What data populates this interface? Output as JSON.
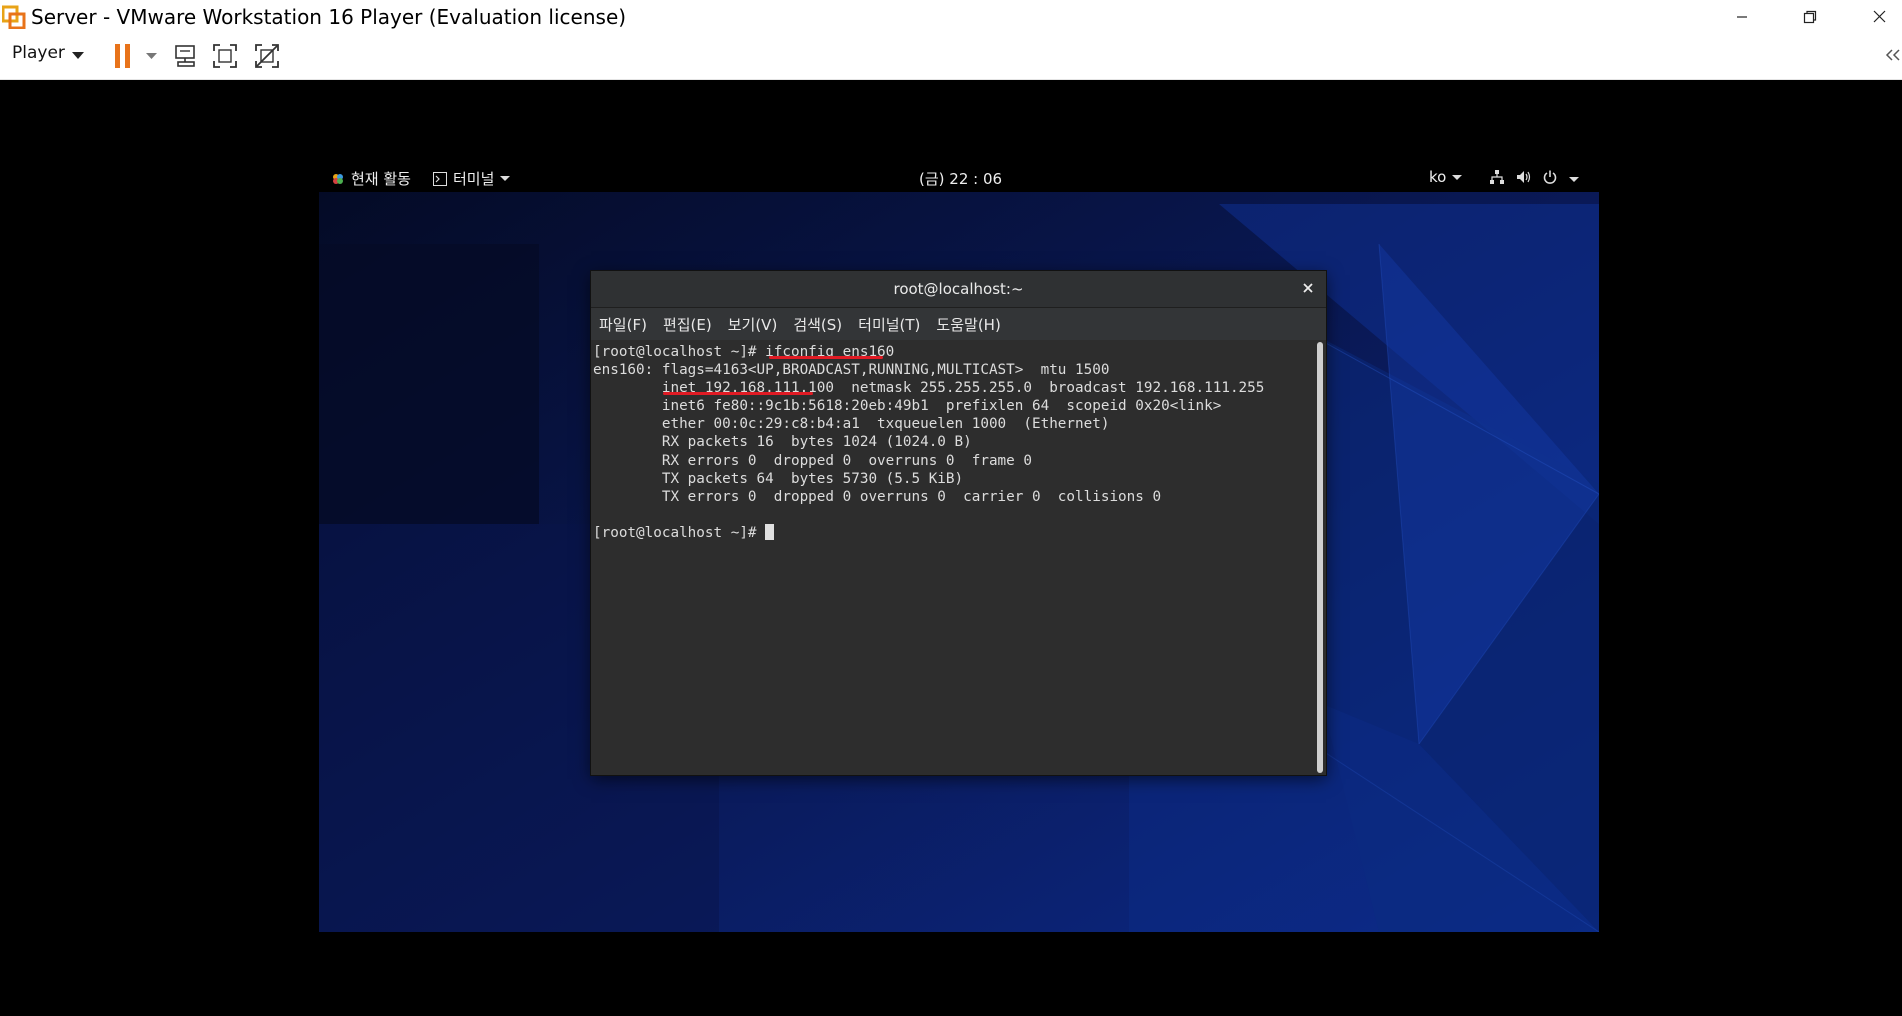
{
  "window": {
    "title": "Server - VMware Workstation 16 Player (Evaluation license)"
  },
  "toolbar": {
    "player_label": "Player",
    "icons": [
      "dropdown-icon",
      "pause-icon",
      "pause-menu-icon",
      "send-ctrl-alt-del-icon",
      "fullscreen-icon",
      "unity-icon",
      "collapse-icon"
    ]
  },
  "gnome_top_bar": {
    "activities": "현재 활동",
    "app_menu": "터미널",
    "clock": "(금) 22 : 06",
    "input_source": "ko"
  },
  "terminal": {
    "title": "root@localhost:~",
    "menu": [
      "파일(F)",
      "편집(E)",
      "보기(V)",
      "검색(S)",
      "터미널(T)",
      "도움말(H)"
    ],
    "lines": [
      "[root@localhost ~]# ifconfig ens160",
      "ens160: flags=4163<UP,BROADCAST,RUNNING,MULTICAST>  mtu 1500",
      "        inet 192.168.111.100  netmask 255.255.255.0  broadcast 192.168.111.255",
      "        inet6 fe80::9c1b:5618:20eb:49b1  prefixlen 64  scopeid 0x20<link>",
      "        ether 00:0c:29:c8:b4:a1  txqueuelen 1000  (Ethernet)",
      "        RX packets 16  bytes 1024 (1024.0 B)",
      "        RX errors 0  dropped 0  overruns 0  frame 0",
      "        TX packets 64  bytes 5730 (5.5 KiB)",
      "        TX errors 0  dropped 0 overruns 0  carrier 0  collisions 0",
      "",
      "[root@localhost ~]# "
    ]
  },
  "colors": {
    "annotation": "#e01b24",
    "pause_orange": "#e8731a",
    "terminal_bg": "#2d2d2d"
  }
}
